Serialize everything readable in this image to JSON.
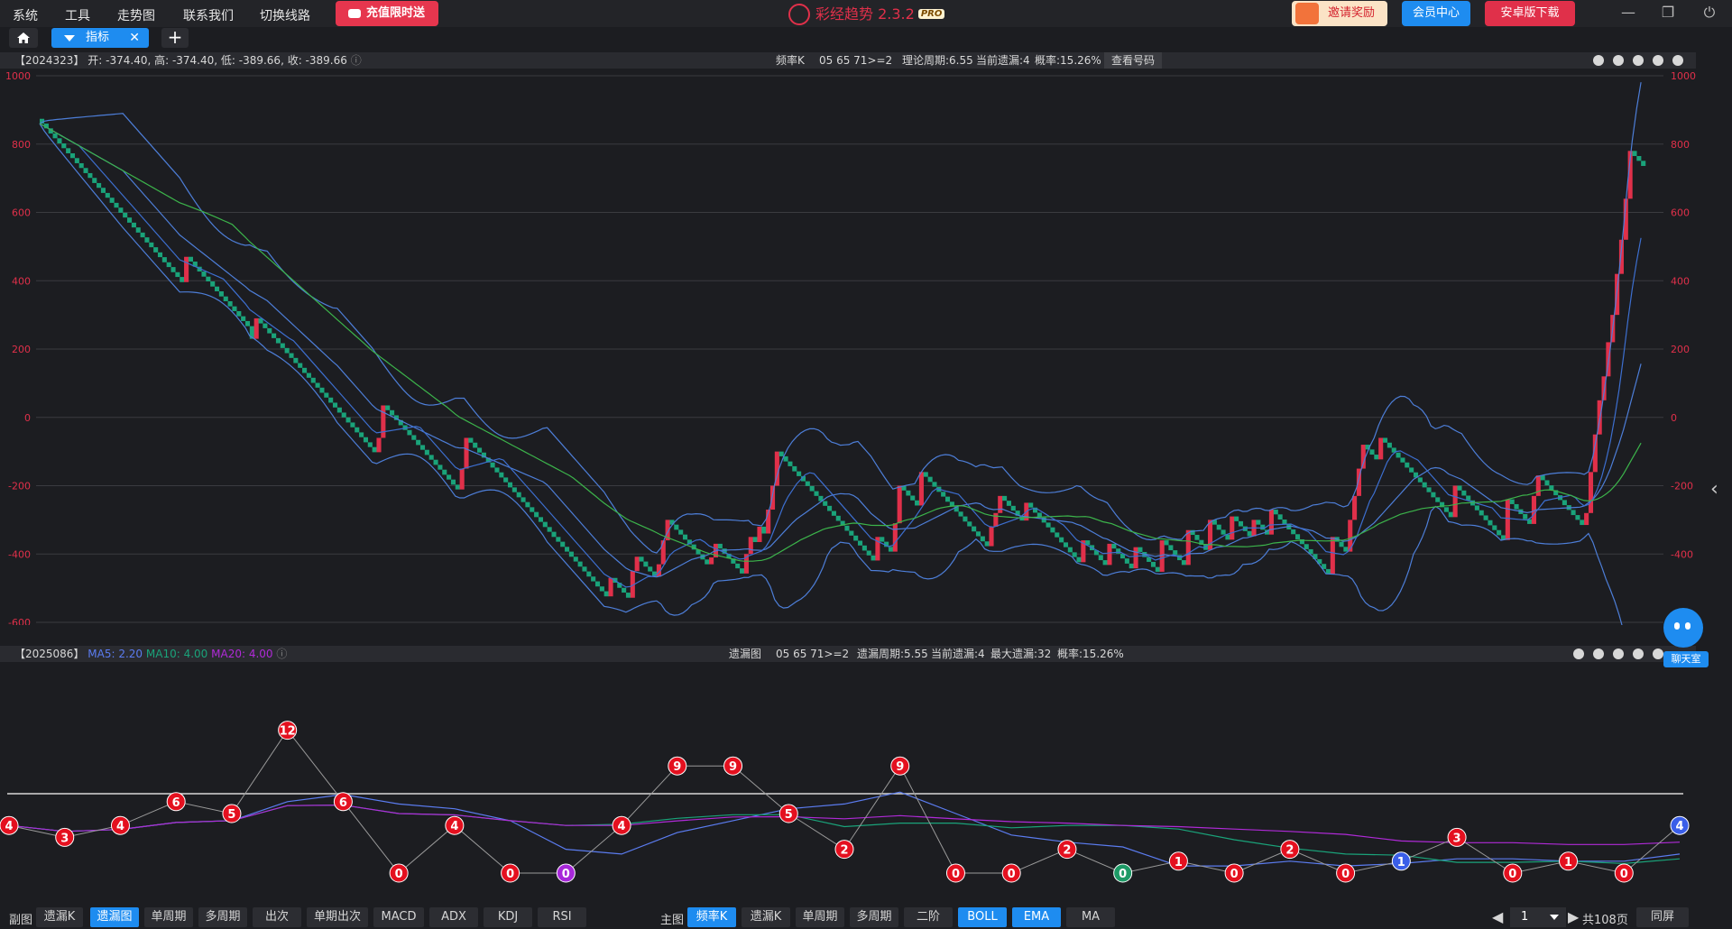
{
  "menu": {
    "items": [
      "系统",
      "工具",
      "走势图",
      "联系我们",
      "切换线路"
    ],
    "recharge": "充值限时送"
  },
  "app": {
    "title": "彩经趋势 2.3.2",
    "badge": "PRO"
  },
  "header": {
    "invite": "邀请奖励",
    "member": "会员中心",
    "android": "安卓版下载"
  },
  "tabs": {
    "active": "指标"
  },
  "top_panel": {
    "period": "【2024323】",
    "ohlc": "开: -374.40, 高: -374.40, 低: -389.66, 收: -389.66",
    "type": "频率K",
    "numbers": "05 65 71>=2",
    "theory": "理论周期:6.55",
    "current": "当前遗漏:4",
    "prob": "概率:15.26%",
    "view_btn": "查看号码"
  },
  "bottom_panel": {
    "period": "【2025086】",
    "ma5": "MA5: 2.20",
    "ma10": "MA10: 4.00",
    "ma20": "MA20: 4.00",
    "type": "遗漏图",
    "numbers": "05 65 71>=2",
    "cycle": "遗漏周期:5.55",
    "current": "当前遗漏:4",
    "max": "最大遗漏:32",
    "prob": "概率:15.26%"
  },
  "chat": {
    "label": "聊天室"
  },
  "bottombar": {
    "sub_label": "副图",
    "sub_buttons": [
      "遗漏K",
      "遗漏图",
      "单周期",
      "多周期",
      "出次",
      "单期出次",
      "MACD",
      "ADX",
      "KDJ",
      "RSI"
    ],
    "main_label": "主图",
    "main_buttons": [
      "频率K",
      "遗漏K",
      "单周期",
      "多周期",
      "二阶",
      "BOLL",
      "EMA",
      "MA"
    ],
    "page": "1",
    "total": "共108页",
    "sync": "同屏"
  },
  "colors": {
    "accent": "#1e8cf0",
    "red": "#e0304a",
    "green": "#1aa37a"
  },
  "chart_data": [
    {
      "type": "candlestick-line",
      "ylim": [
        -600,
        1000
      ],
      "yticks": [
        1000,
        800,
        600,
        400,
        200,
        0,
        -200,
        -400,
        -600
      ],
      "closes": [
        860,
        846,
        831,
        817,
        802,
        788,
        773,
        759,
        744,
        730,
        715,
        701,
        686,
        672,
        657,
        643,
        628,
        614,
        599,
        585,
        570,
        556,
        541,
        527,
        512,
        498,
        483,
        469,
        454,
        440,
        425,
        411,
        396,
        470,
        456,
        441,
        427,
        412,
        398,
        383,
        369,
        354,
        340,
        325,
        311,
        296,
        282,
        267,
        230,
        290,
        275,
        261,
        246,
        232,
        217,
        203,
        188,
        174,
        159,
        145,
        130,
        116,
        101,
        87,
        72,
        58,
        43,
        29,
        14,
        0,
        -15,
        -29,
        -44,
        -58,
        -73,
        -87,
        -102,
        -60,
        35,
        21,
        6,
        -8,
        -23,
        -37,
        -52,
        -66,
        -81,
        -95,
        -110,
        -124,
        -139,
        -153,
        -168,
        -182,
        -197,
        -211,
        -150,
        -60,
        -74,
        -89,
        -103,
        -118,
        -132,
        -147,
        -161,
        -176,
        -190,
        -205,
        -219,
        -234,
        -248,
        -263,
        -277,
        -292,
        -306,
        -321,
        -335,
        -350,
        -364,
        -379,
        -393,
        -408,
        -422,
        -437,
        -451,
        -466,
        -480,
        -495,
        -509,
        -524,
        -470,
        -484,
        -499,
        -513,
        -528,
        -450,
        -408,
        -422,
        -437,
        -451,
        -466,
        -430,
        -360,
        -300,
        -314,
        -329,
        -343,
        -358,
        -372,
        -387,
        -401,
        -416,
        -430,
        -410,
        -370,
        -384,
        -399,
        -413,
        -428,
        -442,
        -457,
        -400,
        -350,
        -365,
        -320,
        -340,
        -270,
        -200,
        -100,
        -114,
        -129,
        -143,
        -158,
        -172,
        -187,
        -201,
        -216,
        -230,
        -245,
        -259,
        -274,
        -288,
        -303,
        -317,
        -332,
        -346,
        -361,
        -375,
        -390,
        -404,
        -419,
        -350,
        -364,
        -379,
        -393,
        -310,
        -200,
        -214,
        -229,
        -243,
        -258,
        -160,
        -174,
        -189,
        -203,
        -218,
        -232,
        -247,
        -261,
        -276,
        -290,
        -305,
        -319,
        -334,
        -348,
        -363,
        -377,
        -320,
        -280,
        -230,
        -244,
        -259,
        -273,
        -288,
        -302,
        -250,
        -264,
        -279,
        -293,
        -308,
        -322,
        -337,
        -351,
        -366,
        -380,
        -395,
        -409,
        -424,
        -360,
        -374,
        -389,
        -403,
        -418,
        -432,
        -370,
        -384,
        -399,
        -413,
        -428,
        -442,
        -380,
        -394,
        -409,
        -423,
        -438,
        -452,
        -360,
        -374,
        -389,
        -403,
        -418,
        -432,
        -330,
        -344,
        -359,
        -373,
        -388,
        -300,
        -314,
        -329,
        -343,
        -358,
        -290,
        -304,
        -319,
        -333,
        -348,
        -300,
        -314,
        -329,
        -343,
        -270,
        -284,
        -299,
        -313,
        -328,
        -342,
        -357,
        -371,
        -386,
        -400,
        -415,
        -429,
        -444,
        -458,
        -350,
        -364,
        -379,
        -393,
        -300,
        -230,
        -150,
        -80,
        -94,
        -109,
        -123,
        -60,
        -74,
        -89,
        -103,
        -118,
        -132,
        -147,
        -161,
        -176,
        -190,
        -205,
        -219,
        -234,
        -248,
        -263,
        -277,
        -292,
        -200,
        -214,
        -229,
        -243,
        -258,
        -272,
        -287,
        -301,
        -316,
        -330,
        -345,
        -359,
        -240,
        -254,
        -269,
        -283,
        -298,
        -312,
        -230,
        -170,
        -184,
        -199,
        -213,
        -228,
        -242,
        -257,
        -271,
        -286,
        -300,
        -315,
        -280,
        -160,
        -50,
        50,
        120,
        220,
        300,
        420,
        520,
        640,
        780,
        765,
        751,
        736
      ]
    },
    {
      "type": "line",
      "title": "遗漏图",
      "values": [
        4,
        3,
        4,
        6,
        5,
        12,
        6,
        0,
        4,
        0,
        0,
        4,
        9,
        9,
        5,
        2,
        9,
        0,
        0,
        2,
        0,
        1,
        0,
        2,
        0,
        1,
        3,
        0,
        1,
        0,
        4
      ]
    }
  ]
}
